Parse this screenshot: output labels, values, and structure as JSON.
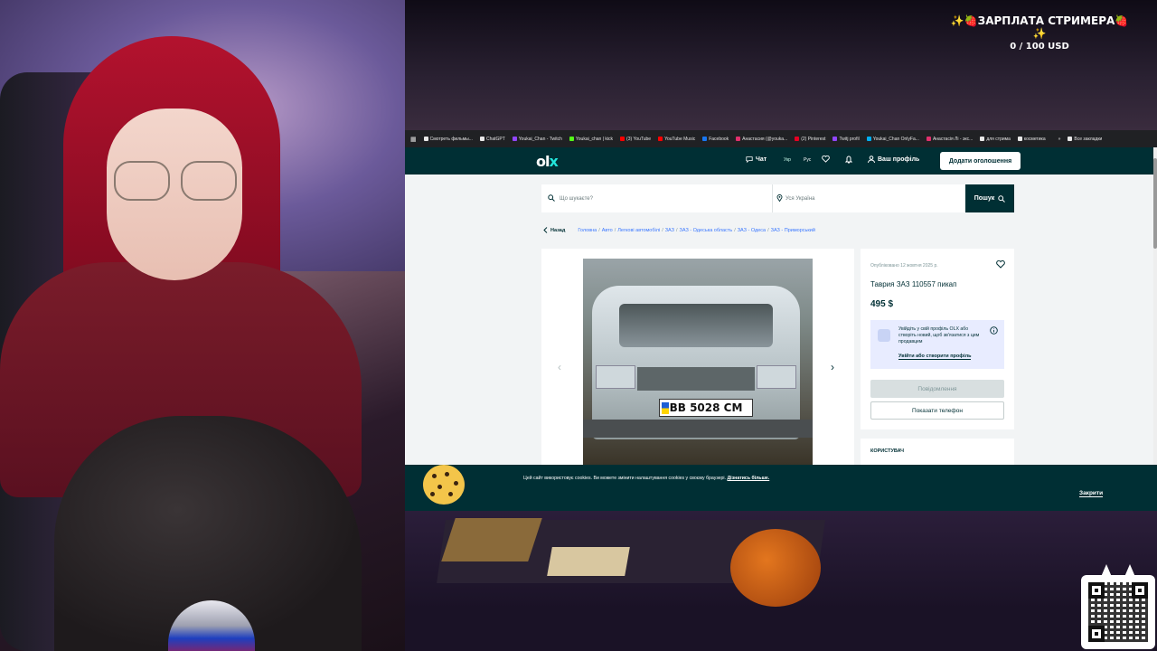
{
  "goal": {
    "title": "✨🍓ЗАРПЛАТА СТРИМЕРА🍓✨",
    "amount": "0 / 100 USD"
  },
  "bookmarks": [
    {
      "label": "Смотреть фильмы...",
      "color": "#e8e8e8"
    },
    {
      "label": "ChatGPT",
      "color": "#e8e8e8"
    },
    {
      "label": "Youkai_Chan - Twitch",
      "color": "#9146ff"
    },
    {
      "label": "Youkai_chan | kick",
      "color": "#53fc18"
    },
    {
      "label": "(3) YouTube",
      "color": "#ff0000"
    },
    {
      "label": "YouTube Music",
      "color": "#ff0000"
    },
    {
      "label": "Facebook",
      "color": "#1877f2"
    },
    {
      "label": "Анастасия (@youka...",
      "color": "#e1306c"
    },
    {
      "label": "(2) Pinterest",
      "color": "#e60023"
    },
    {
      "label": "Twitj profil",
      "color": "#9146ff"
    },
    {
      "label": "Youkai_Chan OnlyFa...",
      "color": "#00aff0"
    },
    {
      "label": "Анастасія Лі - экс...",
      "color": "#e1306c"
    },
    {
      "label": "для стрима",
      "color": "#e8e8e8"
    },
    {
      "label": "косметика",
      "color": "#e8e8e8"
    }
  ],
  "bookmarks_all": "Все закладки",
  "olx": {
    "logo_o": "ol",
    "logo_x": "x",
    "chat": "Чат",
    "lang_uk": "Укр",
    "lang_ru": "Рус",
    "profile": "Ваш профіль",
    "post_ad": "Додати оголошення",
    "search_placeholder": "Що шукаєте?",
    "location_placeholder": "Уся Україна",
    "search_button": "Пошук",
    "back": "Назад",
    "breadcrumbs": [
      "Головна",
      "Авто",
      "Легкові автомобілі",
      "ЗАЗ",
      "ЗАЗ - Одеська область",
      "ЗАЗ - Одеса",
      "ЗАЗ - Приморський"
    ],
    "published": "Опубліковано 12 жовтня 2025 р.",
    "title": "Таврия ЗАЗ 110557 пикап",
    "price": "495 $",
    "login_text": "Увійдіть у свій профіль OLX або створіть новий, щоб зв'язатися з цим продавцем",
    "login_link": "Увійти або створити профіль",
    "message_button": "Повідомлення",
    "phone_button": "Показати телефон",
    "user_label": "КОРИСТУВАЧ",
    "plate": "BB 5028 CM"
  },
  "cookie": {
    "text": "Цей сайт використовує cookies. Ви можете змінити налаштування cookies у своєму браузері.",
    "link": "Дізнатись більше.",
    "close": "Закрити"
  },
  "colors": {
    "olx_dark": "#002f34",
    "olx_accent": "#23e5db"
  }
}
